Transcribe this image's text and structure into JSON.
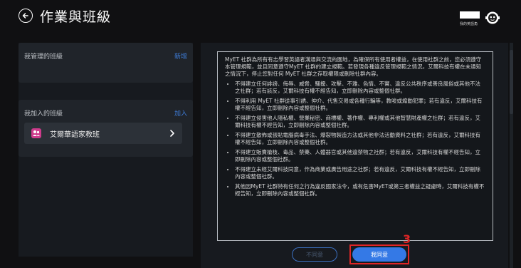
{
  "header": {
    "title": "作業與班級",
    "vip_label": "我的英語角",
    "back_icon": "back-arrow-icon",
    "avatar_icon": "robot-avatar-icon"
  },
  "left": {
    "managed_title": "我管理的班級",
    "managed_action": "新增",
    "joined_title": "我加入的班級",
    "joined_action": "加入",
    "class_name": "艾爾華語家教班",
    "class_icon_color": "#ce3b8c"
  },
  "terms": {
    "intro": "MyET 社群為所有有志學習英語者溝通與交流的園地，為確保所有使用者權益，在使用社群之前，您必須遵守本管理規範，並且同意遵守MyET 社群的建立規範。若發現各種違反管理規範之情況，艾爾科技有權在未通知之情況下，停止您對任何 MyET 社群之存取權限或刪除社群內容。",
    "items": [
      "不得建立任何誹謗、侮辱、威脅、騷擾、攻擊、不雅、色情、不實、違反公共秩序或善良風俗或其他不法之社群；若有該反，艾爾科技有權不經告知，立即刪除內容或整個社群。",
      "不得利用 MyET 社群從事引誘、仲介、代售交易或各種行騙等，教唆或煽動犯罪；若有違反，艾爾科技有權不經告知，立即刪除內容或整個社群。",
      "不得建立侵害他人隱私權、營業秘密、商標權、著作權、專利權或其他智慧財產權之社群；若有違反，艾爾科技有權不經告知，立即刪除內容或整個社群。",
      "不得建立散佈或張貼電腦病毒手法、爆裂物製造方法或其他非法活動資料之社群；若有違反，艾爾科技有權不經告知，立即刪除內容或整個社群。",
      "不得建立販賣槍枝、毒品、禁藥、人體器官或其他違禁物之社群；若有違反，艾爾科技有權不經告知，立即刪除內容或整個社群。",
      "不得建立未經艾爾科技同意，作為商業或廣告用途之社群；若有違反，艾爾科技有權不經告知，立即刪除內容或整個社群。",
      "其他因MyET 社群特有任何之行為違反國家法令，或有危害MyET或第三者權益之疑慮時，艾爾科技有權不經告知，立即刪除內容或整個社群。"
    ]
  },
  "buttons": {
    "disagree": "不同意",
    "agree": "我同意"
  },
  "annotation": {
    "step": "3",
    "color": "#e02525"
  }
}
